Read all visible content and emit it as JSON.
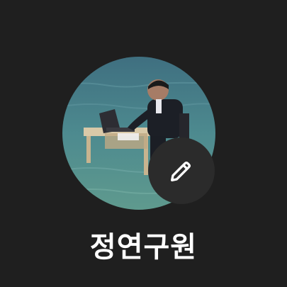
{
  "profile": {
    "display_name": "정연구원",
    "avatar_description": "profile-photo",
    "edit_icon": "pencil-icon"
  },
  "colors": {
    "background": "#1f1f1f",
    "edit_button_bg": "#2b2b2b",
    "name_text": "#ffffff",
    "icon": "#ffffff"
  }
}
